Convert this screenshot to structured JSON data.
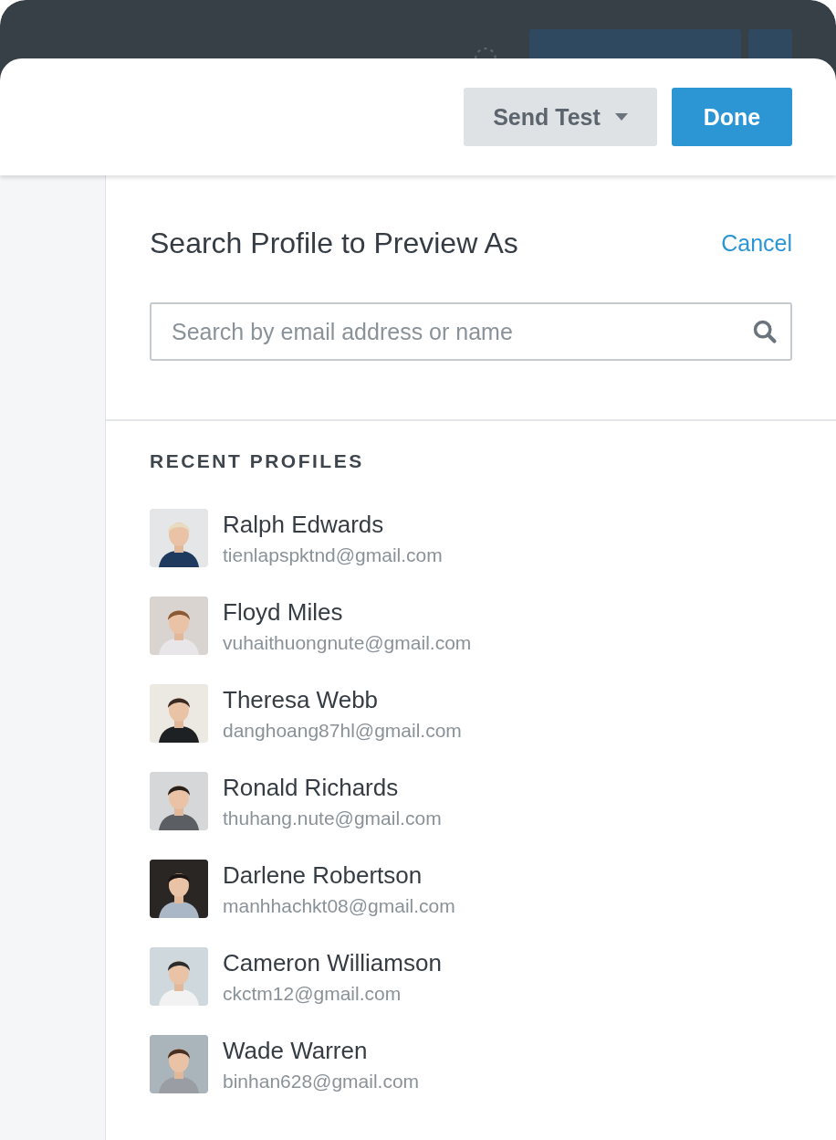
{
  "toolbar": {
    "send_test": "Send Test",
    "done": "Done"
  },
  "panel": {
    "title": "Search Profile to Preview As",
    "cancel": "Cancel",
    "search": {
      "placeholder": "Search by email address or name"
    }
  },
  "recent_profiles": {
    "heading": "RECENT PROFILES",
    "profiles": [
      {
        "name": "Ralph Edwards",
        "email": "tienlapspktnd@gmail.com"
      },
      {
        "name": "Floyd Miles",
        "email": "vuhaithuongnute@gmail.com"
      },
      {
        "name": "Theresa Webb",
        "email": "danghoang87hl@gmail.com"
      },
      {
        "name": "Ronald Richards",
        "email": "thuhang.nute@gmail.com"
      },
      {
        "name": "Darlene Robertson",
        "email": "manhhachkt08@gmail.com"
      },
      {
        "name": "Cameron Williamson",
        "email": "ckctm12@gmail.com"
      },
      {
        "name": "Wade Warren",
        "email": "binhan628@gmail.com"
      }
    ]
  }
}
